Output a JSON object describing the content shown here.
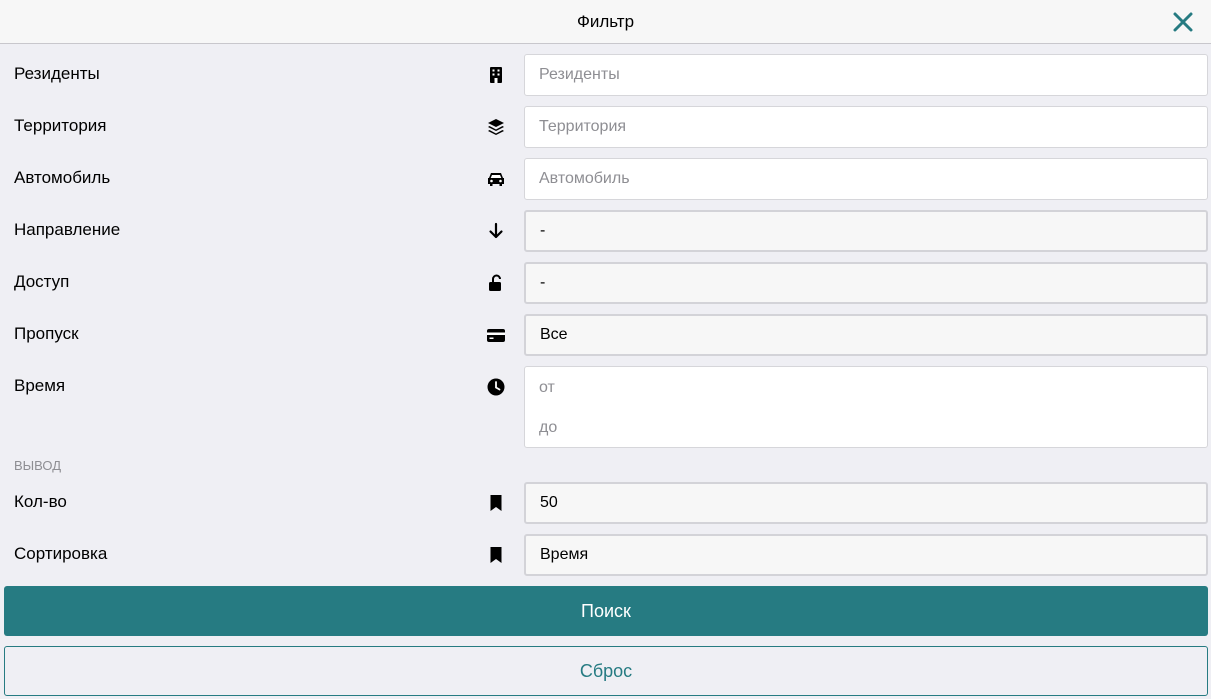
{
  "header": {
    "title": "Фильтр",
    "close_icon": "close-icon"
  },
  "filters": {
    "residents": {
      "label": "Резиденты",
      "icon": "building-icon",
      "placeholder": "Резиденты",
      "value": ""
    },
    "territory": {
      "label": "Территория",
      "icon": "layers-icon",
      "placeholder": "Территория",
      "value": ""
    },
    "car": {
      "label": "Автомобиль",
      "icon": "car-icon",
      "placeholder": "Автомобиль",
      "value": ""
    },
    "direction": {
      "label": "Направление",
      "icon": "arrow-down-icon",
      "value": "-"
    },
    "access": {
      "label": "Доступ",
      "icon": "unlock-icon",
      "value": "-"
    },
    "pass": {
      "label": "Пропуск",
      "icon": "credit-card-icon",
      "value": "Все"
    },
    "time": {
      "label": "Время",
      "icon": "clock-icon",
      "from_placeholder": "от",
      "to_placeholder": "до"
    }
  },
  "output": {
    "section_label": "вывод",
    "count": {
      "label": "Кол-во",
      "icon": "bookmark-icon",
      "value": "50"
    },
    "sort": {
      "label": "Сортировка",
      "icon": "bookmark-icon",
      "value": "Время"
    }
  },
  "actions": {
    "search_label": "Поиск",
    "reset_label": "Сброс"
  },
  "colors": {
    "accent": "#267b82",
    "background": "#efeff4",
    "header_bg": "#f7f7f7"
  }
}
